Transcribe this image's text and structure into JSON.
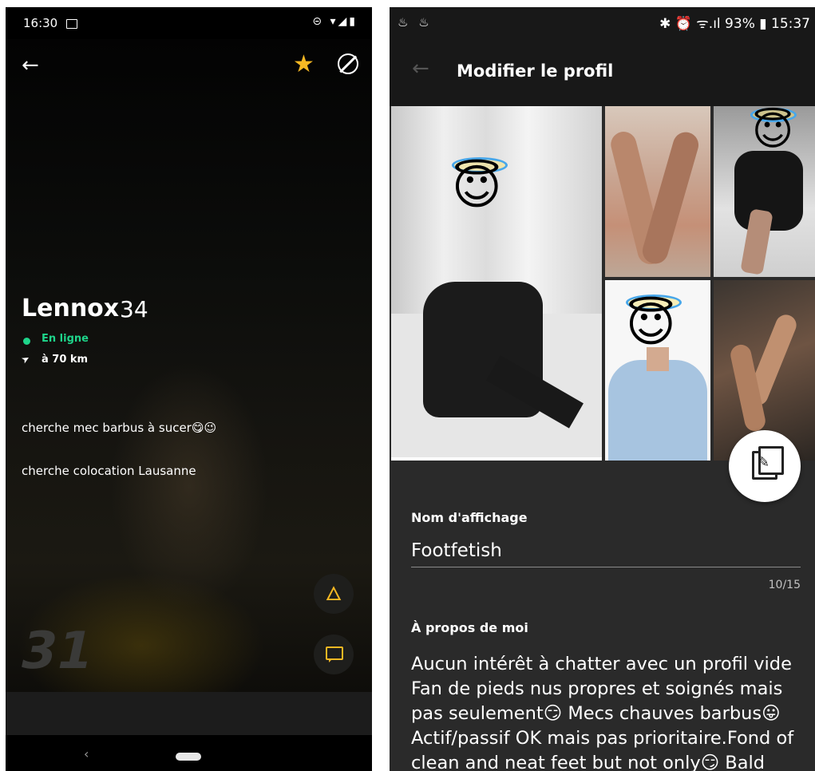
{
  "left": {
    "status": {
      "time": "16:30",
      "icons": "⊝ ▾◢▮"
    },
    "header": {
      "back": "←",
      "star": "★"
    },
    "profile": {
      "name": "Lennox",
      "age": "34",
      "online": "En ligne",
      "distance": "à 70 km",
      "bio_line1": "cherche mec barbus à sucer😋😉",
      "bio_line2": "cherche colocation Lausanne"
    },
    "photo_text": "31",
    "actions": {
      "fire_icon": "fire-icon",
      "chat_icon": "chat-icon"
    },
    "nav": {
      "back": "‹"
    },
    "colors": {
      "accent": "#f5b823",
      "online": "#1ed48a"
    }
  },
  "right": {
    "status": {
      "left_icons": "♨ ♨",
      "right": "✱ ⏰ ᯤ.ıl 93% ▮ 15:37"
    },
    "header": {
      "back": "←",
      "title": "Modifier le profil"
    },
    "emoji": "😇",
    "form": {
      "display_name_label": "Nom d'affichage",
      "display_name_value": "Footfetish",
      "counter": "10/15",
      "about_label": "À propos de moi",
      "about_text": "Aucun intérêt à chatter avec un profil vide\nFan de pieds nus propres et soignés mais pas seulement😏 Mecs chauves barbus😛 Actif/passif OK mais pas prioritaire.Fond of clean and neat feet but not only😏 Bald"
    }
  }
}
